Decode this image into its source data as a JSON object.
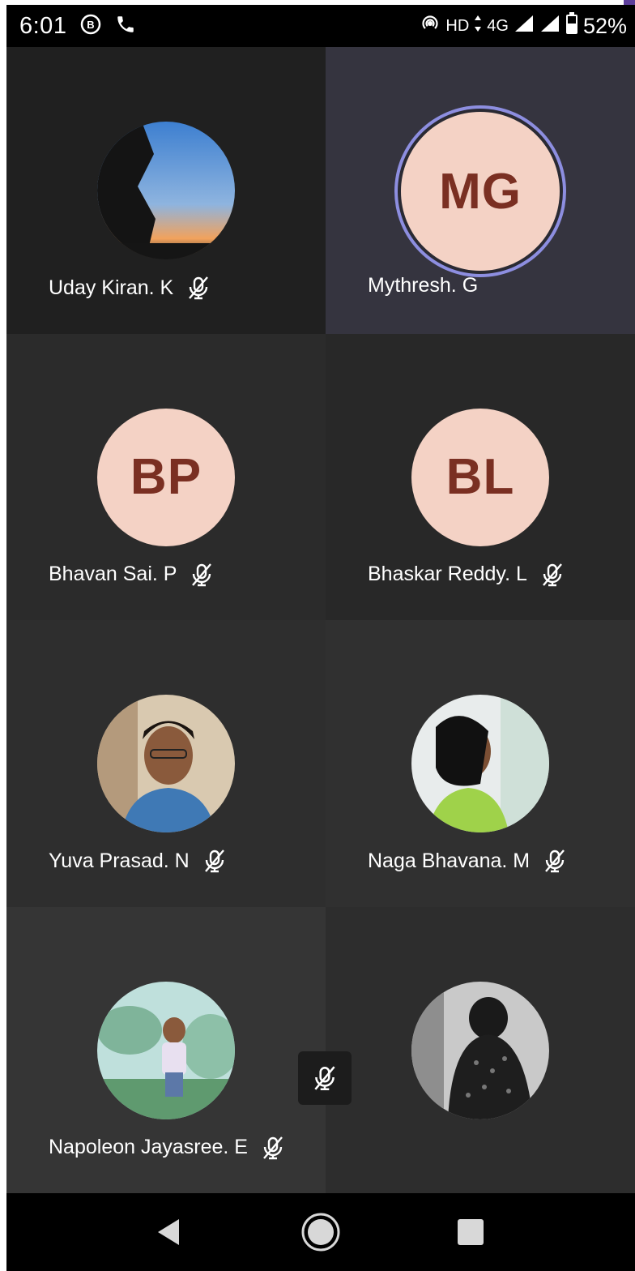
{
  "status_bar": {
    "time": "6:01",
    "network": "HD",
    "network_type": "4G",
    "battery": "52%"
  },
  "participants": [
    {
      "name": "Uday Kiran. K",
      "initials": "",
      "muted": true,
      "avatar_icon": "sunset-photo"
    },
    {
      "name": "Mythresh. G",
      "initials": "MG",
      "muted": false,
      "speaking": true
    },
    {
      "name": "Bhavan Sai. P",
      "initials": "BP",
      "muted": true
    },
    {
      "name": "Bhaskar Reddy. L",
      "initials": "BL",
      "muted": true
    },
    {
      "name": "Yuva Prasad. N",
      "initials": "",
      "muted": true,
      "avatar_icon": "man-photo"
    },
    {
      "name": "Naga Bhavana. M",
      "initials": "",
      "muted": true,
      "avatar_icon": "woman-photo"
    },
    {
      "name": "Napoleon Jayasree. E",
      "initials": "",
      "muted": true,
      "avatar_icon": "anime-photo"
    },
    {
      "name": "",
      "initials": "",
      "muted": false,
      "avatar_icon": "statue-photo"
    }
  ],
  "colors": {
    "initials_bg": "#f4d2c5",
    "initials_text": "#7a2f22",
    "speaking_ring": "#8d8ee0"
  }
}
